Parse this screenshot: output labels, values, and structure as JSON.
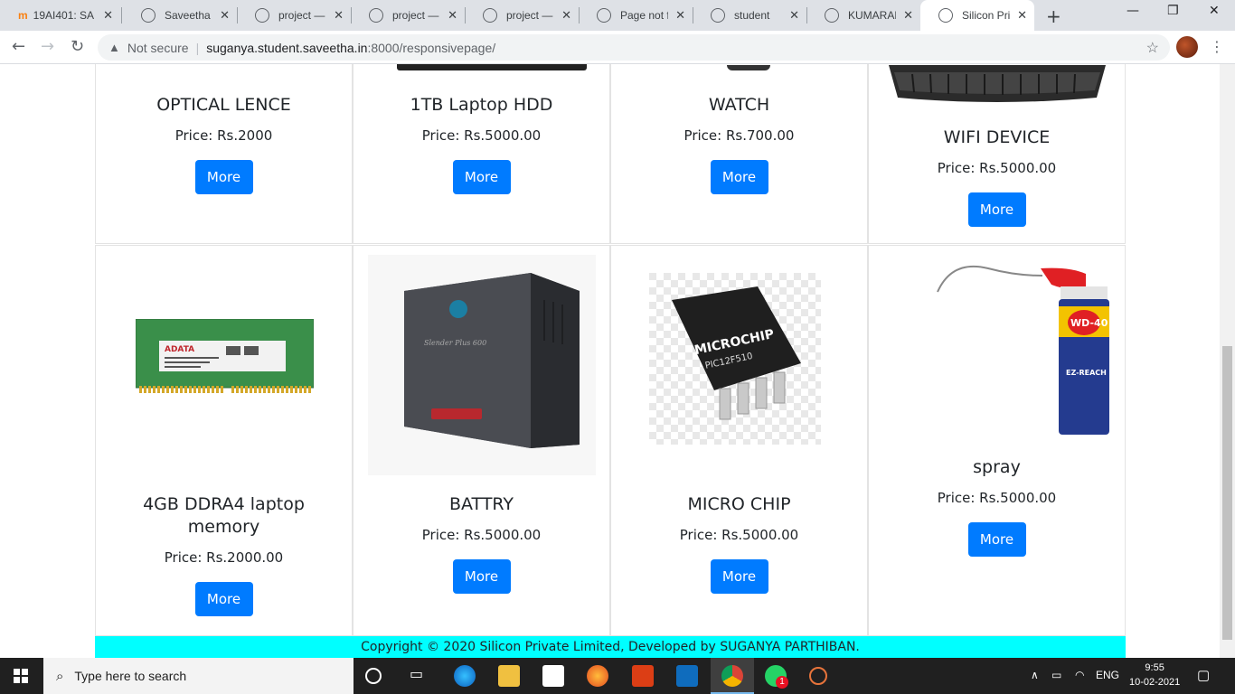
{
  "browser": {
    "tabs": [
      {
        "title": "19AI401: SA",
        "active": false
      },
      {
        "title": "Saveetha En",
        "active": false
      },
      {
        "title": "project — T",
        "active": false
      },
      {
        "title": "project — T",
        "active": false
      },
      {
        "title": "project — T",
        "active": false
      },
      {
        "title": "Page not fo",
        "active": false
      },
      {
        "title": "student",
        "active": false
      },
      {
        "title": "KUMARAN",
        "active": false
      },
      {
        "title": "Silicon Priva",
        "active": true
      }
    ],
    "security_label": "Not secure",
    "url_host": "suganya.student.saveetha.in",
    "url_rest": ":8000/responsivepage/"
  },
  "products": [
    {
      "name": "OPTICAL LENCE",
      "price": "Price: Rs.2000",
      "button": "More"
    },
    {
      "name": "1TB Laptop HDD",
      "price": "Price: Rs.5000.00",
      "button": "More"
    },
    {
      "name": "WATCH",
      "price": "Price: Rs.700.00",
      "button": "More"
    },
    {
      "name": "WIFI DEVICE",
      "price": "Price: Rs.5000.00",
      "button": "More"
    },
    {
      "name": "4GB DDRA4 laptop memory",
      "price": "Price: Rs.2000.00",
      "button": "More"
    },
    {
      "name": "BATTRY",
      "price": "Price: Rs.5000.00",
      "button": "More"
    },
    {
      "name": "MICRO CHIP",
      "price": "Price: Rs.5000.00",
      "button": "More"
    },
    {
      "name": "spray",
      "price": "Price: Rs.5000.00",
      "button": "More"
    }
  ],
  "footer": {
    "text": "Copyright © 2020 Silicon Private Limited, Developed by SUGANYA PARTHIBAN."
  },
  "taskbar": {
    "search_placeholder": "Type here to search",
    "language": "ENG",
    "time": "9:55",
    "date": "10-02-2021",
    "whatsapp_badge": "1"
  },
  "colors": {
    "accent": "#007bff",
    "footer_bg": "#00ffff"
  }
}
